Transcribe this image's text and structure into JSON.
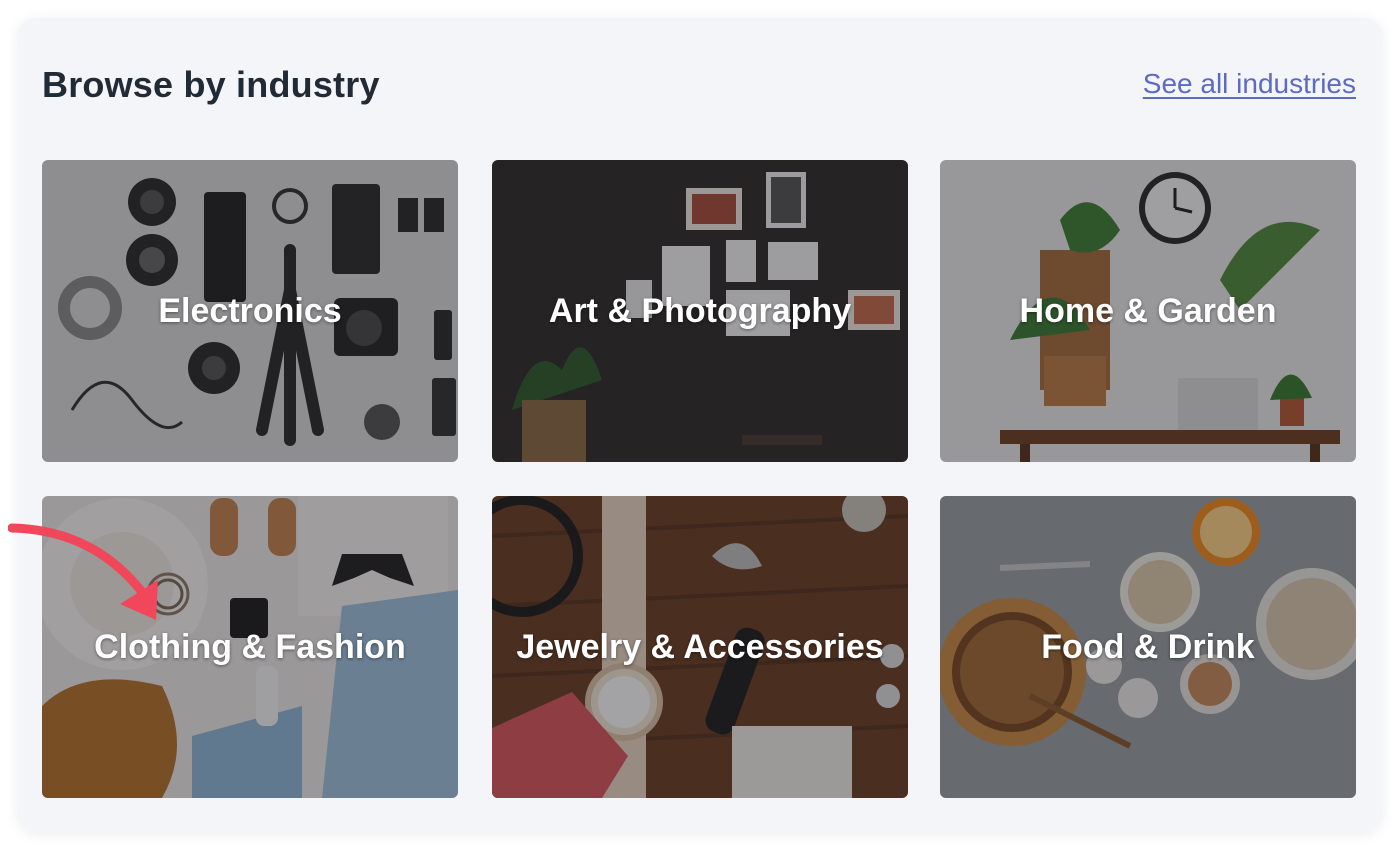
{
  "header": {
    "title": "Browse by industry",
    "see_all_label": "See all industries"
  },
  "industries": [
    {
      "label": "Electronics",
      "image": "electronics-flatlay"
    },
    {
      "label": "Art & Photography",
      "image": "framed-photos-wall"
    },
    {
      "label": "Home & Garden",
      "image": "plants-desk-clock"
    },
    {
      "label": "Clothing & Fashion",
      "image": "clothing-flatlay"
    },
    {
      "label": "Jewelry & Accessories",
      "image": "watch-jewelry-table"
    },
    {
      "label": "Food & Drink",
      "image": "nuts-grains-jars"
    }
  ],
  "annotation": {
    "type": "arrow",
    "color": "#f0475b",
    "points_to": "Clothing & Fashion"
  }
}
